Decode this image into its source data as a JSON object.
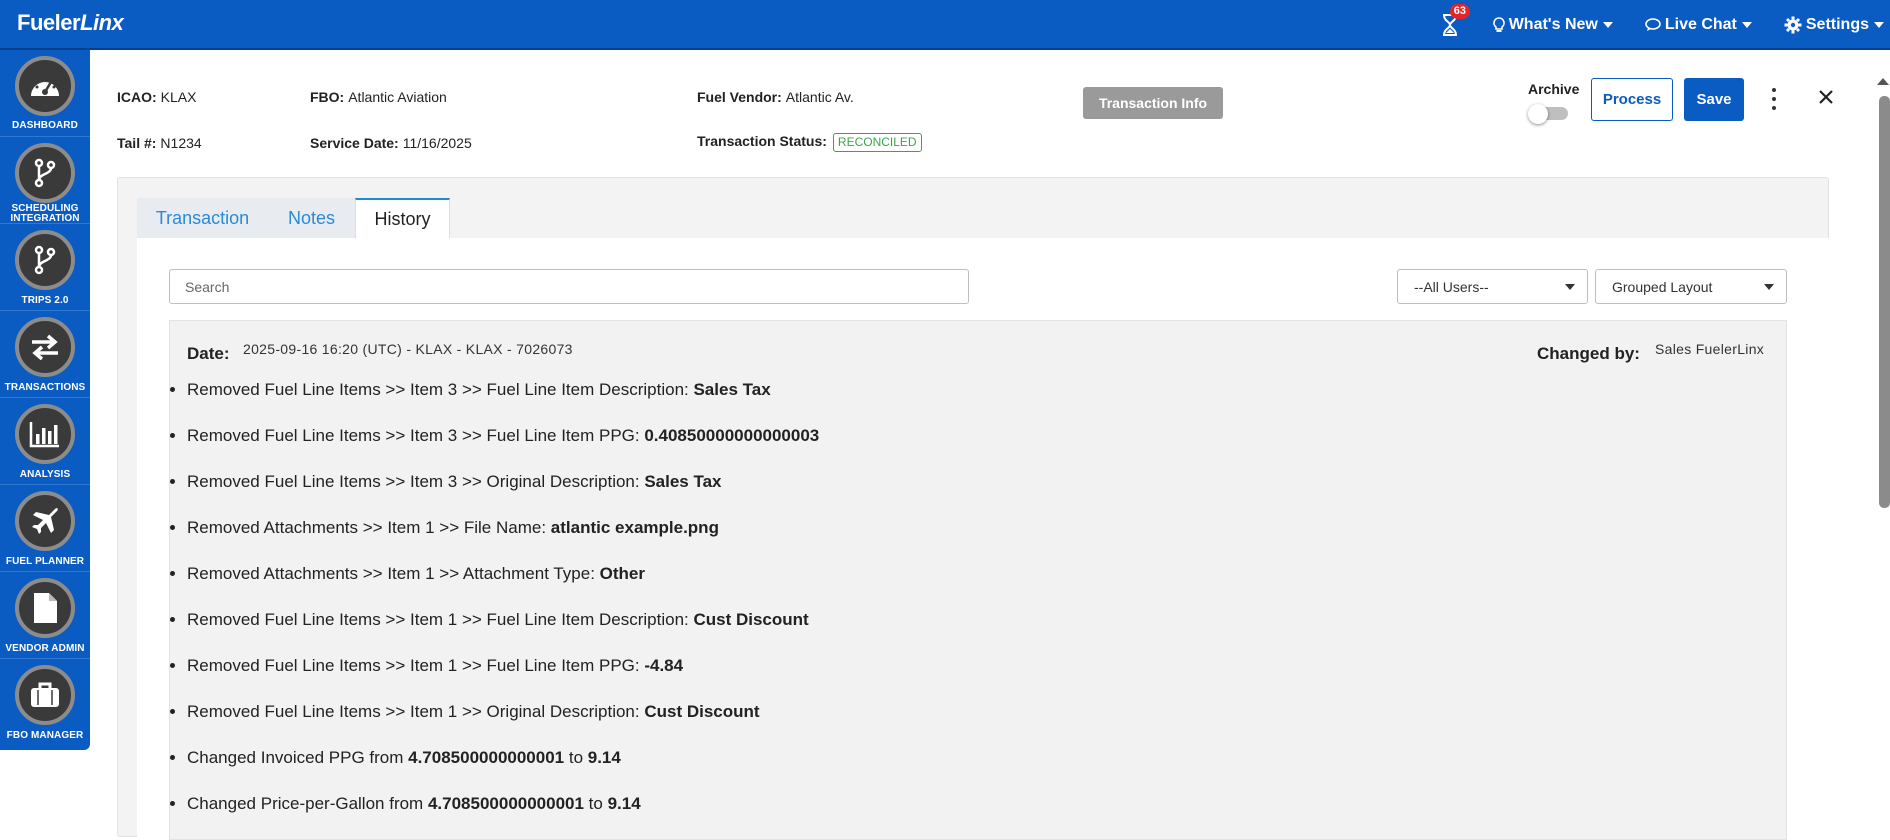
{
  "app": {
    "logo_a": "Fueler",
    "logo_b": "Linx"
  },
  "topbar": {
    "notification_count": "63",
    "menus": [
      {
        "label": "What's New",
        "icon": "lightbulb-icon"
      },
      {
        "label": "Live Chat",
        "icon": "chat-icon"
      },
      {
        "label": "Settings",
        "icon": "gear-icon"
      }
    ]
  },
  "sidebar": {
    "items": [
      {
        "label": "DASHBOARD",
        "icon": "dashboard-gauge-icon"
      },
      {
        "label": "SCHEDULING INTEGRATION",
        "icon": "branch-icon"
      },
      {
        "label": "TRIPS 2.0",
        "icon": "branch-icon"
      },
      {
        "label": "TRANSACTIONS",
        "icon": "exchange-arrows-icon"
      },
      {
        "label": "ANALYSIS",
        "icon": "bar-chart-icon"
      },
      {
        "label": "FUEL PLANNER",
        "icon": "airplane-icon"
      },
      {
        "label": "VENDOR ADMIN",
        "icon": "document-icon"
      },
      {
        "label": "FBO MANAGER",
        "icon": "briefcase-icon"
      }
    ]
  },
  "header": {
    "icao_label": "ICAO:",
    "icao": "KLAX",
    "fbo_label": "FBO:",
    "fbo": "Atlantic Aviation",
    "vendor_label": "Fuel Vendor:",
    "vendor": "Atlantic Av.",
    "tail_label": "Tail #:",
    "tail": "N1234",
    "service_date_label": "Service Date:",
    "service_date": "11/16/2025",
    "status_label": "Transaction Status:",
    "status": "RECONCILED",
    "transaction_info_button": "Transaction Info",
    "archive_label": "Archive",
    "archive_on": false,
    "process_button": "Process",
    "save_button": "Save"
  },
  "tabs": [
    {
      "label": "Transaction",
      "active": false
    },
    {
      "label": "Notes",
      "active": false
    },
    {
      "label": "History",
      "active": true
    }
  ],
  "history": {
    "search_placeholder": "Search",
    "user_filter": "--All Users--",
    "layout_filter": "Grouped Layout",
    "entry": {
      "date_label": "Date:",
      "date": "2025-09-16 16:20 (UTC) - KLAX - KLAX - 7026073",
      "changed_by_label": "Changed by:",
      "changed_by": "Sales FuelerLinx",
      "changes": [
        {
          "text": "Removed Fuel Line Items >> Item 3 >> Fuel Line Item Description: ",
          "value": "Sales Tax"
        },
        {
          "text": "Removed Fuel Line Items >> Item 3 >> Fuel Line Item PPG: ",
          "value": "0.40850000000000003"
        },
        {
          "text": "Removed Fuel Line Items >> Item 3 >> Original Description: ",
          "value": "Sales Tax"
        },
        {
          "text": "Removed Attachments >> Item 1 >> File Name: ",
          "value": "atlantic example.png"
        },
        {
          "text": "Removed Attachments >> Item 1 >> Attachment Type: ",
          "value": "Other"
        },
        {
          "text": "Removed Fuel Line Items >> Item 1 >> Fuel Line Item Description: ",
          "value": "Cust Discount"
        },
        {
          "text": "Removed Fuel Line Items >> Item 1 >> Fuel Line Item PPG: ",
          "value": "-4.84"
        },
        {
          "text": "Removed Fuel Line Items >> Item 1 >> Original Description: ",
          "value": "Cust Discount"
        },
        {
          "text": "Changed Invoiced PPG from ",
          "value": "4.708500000000001",
          "mid": " to ",
          "value2": "9.14"
        },
        {
          "text": "Changed Price-per-Gallon from ",
          "value": "4.708500000000001",
          "mid": " to ",
          "value2": "9.14"
        }
      ]
    }
  },
  "colors": {
    "brand": "#0a5cc2",
    "status_ok": "#3aa54a",
    "tab_link": "#2a8ad4"
  }
}
